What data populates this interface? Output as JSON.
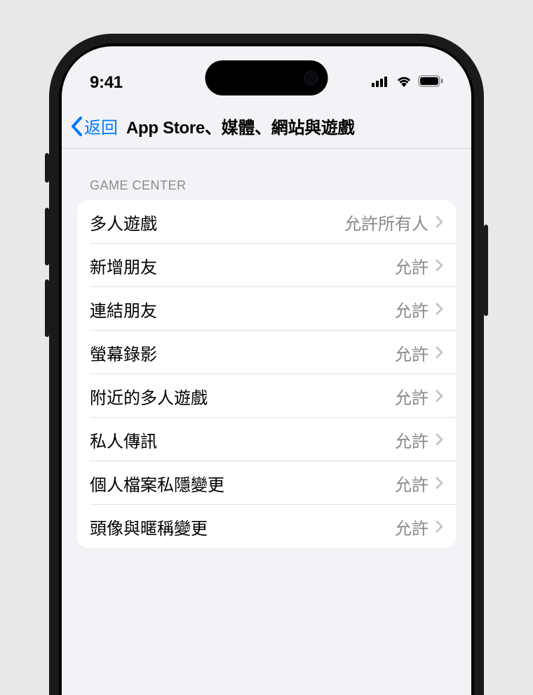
{
  "status_bar": {
    "time": "9:41"
  },
  "nav": {
    "back_label": "返回",
    "title": "App Store、媒體、網站與遊戲"
  },
  "section_header": "GAME CENTER",
  "rows": [
    {
      "label": "多人遊戲",
      "value": "允許所有人"
    },
    {
      "label": "新增朋友",
      "value": "允許"
    },
    {
      "label": "連結朋友",
      "value": "允許"
    },
    {
      "label": "螢幕錄影",
      "value": "允許"
    },
    {
      "label": "附近的多人遊戲",
      "value": "允許"
    },
    {
      "label": "私人傳訊",
      "value": "允許"
    },
    {
      "label": "個人檔案私隱變更",
      "value": "允許"
    },
    {
      "label": "頭像與暱稱變更",
      "value": "允許"
    }
  ]
}
